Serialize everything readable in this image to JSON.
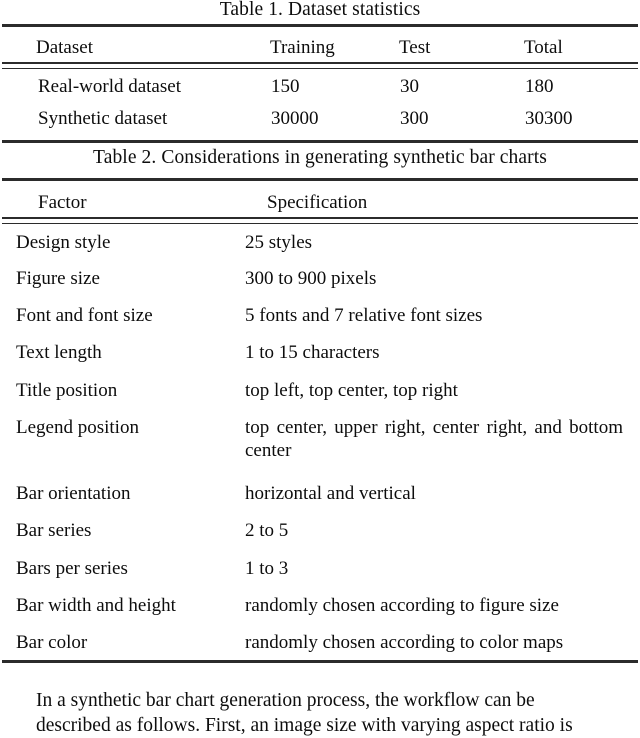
{
  "table1": {
    "caption": "Table 1. Dataset statistics",
    "columns": [
      "Dataset",
      "Training",
      "Test",
      "Total"
    ],
    "rows": [
      {
        "dataset": "Real-world dataset",
        "training": "150",
        "test": "30",
        "total": "180"
      },
      {
        "dataset": "Synthetic dataset",
        "training": "30000",
        "test": "300",
        "total": "30300"
      }
    ]
  },
  "table2": {
    "caption": "Table 2. Considerations in generating synthetic bar charts",
    "columns": [
      "Factor",
      "Specification"
    ],
    "rows": [
      {
        "factor": "Design style",
        "specification": "25 styles"
      },
      {
        "factor": "Figure size",
        "specification": "300 to 900 pixels"
      },
      {
        "factor": "Font and font size",
        "specification": "5 fonts and 7 relative font sizes"
      },
      {
        "factor": "Text length",
        "specification": "1 to 15 characters"
      },
      {
        "factor": "Title position",
        "specification": "top left, top center, top right"
      },
      {
        "factor": "Legend position",
        "specification": "top center, upper right, center right, and bottom center"
      },
      {
        "factor": "Bar orientation",
        "specification": "horizontal and vertical"
      },
      {
        "factor": "Bar series",
        "specification": "2 to 5"
      },
      {
        "factor": "Bars per series",
        "specification": "1 to 3"
      },
      {
        "factor": "Bar width and height",
        "specification": "randomly chosen according to figure size"
      },
      {
        "factor": "Bar color",
        "specification": "randomly chosen according to color maps"
      }
    ]
  },
  "body": {
    "paragraph_line1": "In a synthetic bar chart generation process, the workflow can be",
    "paragraph_line2": "described as follows. First, an image size with varying aspect ratio is"
  },
  "colors": {
    "text": "#0d0d0d",
    "rule": "#2b2b2b",
    "background": "#ffffff"
  }
}
